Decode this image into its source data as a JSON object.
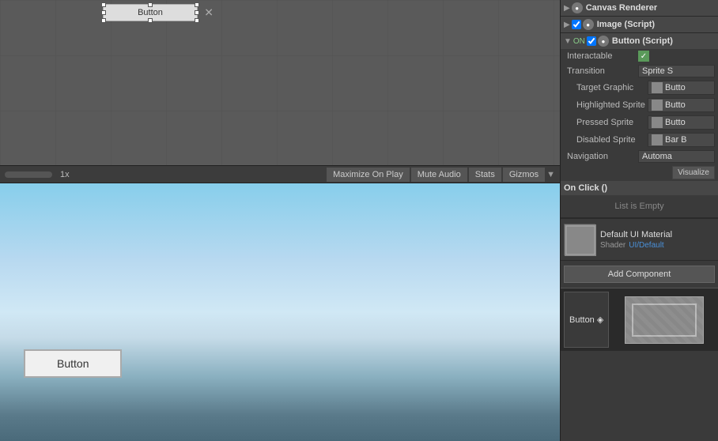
{
  "scene_view": {
    "button_label": "Button",
    "button_preview_label": "Button"
  },
  "game_toolbar": {
    "zoom": "1x",
    "maximize_label": "Maximize On Play",
    "mute_label": "Mute Audio",
    "stats_label": "Stats",
    "gizmos_label": "Gizmos"
  },
  "inspector": {
    "canvas_renderer": {
      "title": "Canvas Renderer"
    },
    "image_script": {
      "title": "Image (Script)"
    },
    "button_script": {
      "title": "Button (Script)",
      "interactable_label": "Interactable",
      "interactable_value": "✓",
      "transition_label": "Transition",
      "transition_value": "Sprite S",
      "target_graphic_label": "Target Graphic",
      "target_graphic_value": "Butto",
      "highlighted_sprite_label": "Highlighted Sprite",
      "highlighted_value": "Butto",
      "pressed_sprite_label": "Pressed Sprite",
      "pressed_value": "Butto",
      "disabled_sprite_label": "Disabled Sprite",
      "disabled_value": "Bar B",
      "navigation_label": "Navigation",
      "navigation_value": "Automa"
    },
    "on_click": {
      "title": "On Click ()",
      "empty_label": "List is Empty"
    },
    "material": {
      "name": "Default UI Material",
      "shader_label": "Shader",
      "shader_value": "UI/Default"
    },
    "add_component": "Add Component"
  },
  "preview_strip": {
    "label": "Button ◈"
  }
}
